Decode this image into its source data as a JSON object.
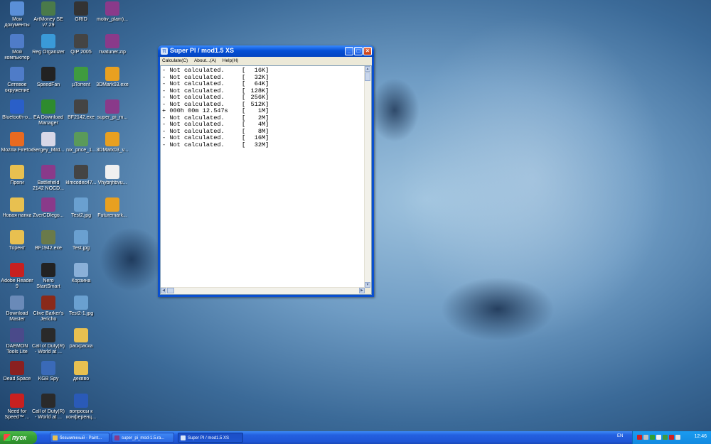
{
  "desktop": {
    "icons": [
      {
        "label": "Мои документы",
        "icon": "folder-docs-icon",
        "color": "#5a8fd8"
      },
      {
        "label": "ArtMoney SE v7.29",
        "icon": "artmoney-icon",
        "color": "#4a7a4a"
      },
      {
        "label": "GRID",
        "icon": "grid-game-icon",
        "color": "#333333"
      },
      {
        "label": "motiv_plam)...",
        "icon": "winrar-icon",
        "color": "#8a3a8a"
      },
      {
        "label": "Мой компьютер",
        "icon": "computer-icon",
        "color": "#4f7cc8"
      },
      {
        "label": "Reg Organizer",
        "icon": "reg-organizer-icon",
        "color": "#3a9ad8"
      },
      {
        "label": "QIP 2005",
        "icon": "qip-icon",
        "color": "#444444"
      },
      {
        "label": "rivatuner.zip",
        "icon": "winrar-icon",
        "color": "#8a3a8a"
      },
      {
        "label": "Сетевое окружение",
        "icon": "network-icon",
        "color": "#4f7cc8"
      },
      {
        "label": "SpeedFan",
        "icon": "speedfan-icon",
        "color": "#222222"
      },
      {
        "label": "µTorrent",
        "icon": "utorrent-icon",
        "color": "#3f9b3f"
      },
      {
        "label": "3DMark03.exe",
        "icon": "futuremark-icon",
        "color": "#e8a020"
      },
      {
        "label": "Bluetooth-о...",
        "icon": "bluetooth-icon",
        "color": "#2a5fc8"
      },
      {
        "label": "EA Download Manager",
        "icon": "ea-icon",
        "color": "#2e8b2e"
      },
      {
        "label": "BF2142.exe",
        "icon": "bf2142-icon",
        "color": "#444444"
      },
      {
        "label": "super_pi_m...",
        "icon": "winrar-icon",
        "color": "#8a3a8a"
      },
      {
        "label": "Mozilla Firefox",
        "icon": "firefox-icon",
        "color": "#e86a20"
      },
      {
        "label": "Sergey_Mild...",
        "icon": "document-icon",
        "color": "#d8d8e8"
      },
      {
        "label": "nix_price_1...",
        "icon": "spreadsheet-icon",
        "color": "#5a9a5a"
      },
      {
        "label": "3DMark03_v...",
        "icon": "futuremark-icon",
        "color": "#e8a020"
      },
      {
        "label": "Проги",
        "icon": "folder-icon",
        "color": "#e8c050"
      },
      {
        "label": "Battlefield 2142 NOCD...",
        "icon": "winrar-icon",
        "color": "#8a3a8a"
      },
      {
        "label": "klmcodec47...",
        "icon": "codec-icon",
        "color": "#444444"
      },
      {
        "label": "Vhybrjhbvu...",
        "icon": "text-file-icon",
        "color": "#f0f0f0"
      },
      {
        "label": "Новая папка",
        "icon": "folder-icon",
        "color": "#e8c050"
      },
      {
        "label": "ZverCDlego...",
        "icon": "winrar-icon",
        "color": "#8a3a8a"
      },
      {
        "label": "Test2.jpg",
        "icon": "image-icon",
        "color": "#6aa0d0"
      },
      {
        "label": "Futuremark...",
        "icon": "futuremark-icon",
        "color": "#e8a020"
      },
      {
        "label": "Торент",
        "icon": "folder-icon",
        "color": "#e8c050"
      },
      {
        "label": "BF1942.exe",
        "icon": "bf1942-icon",
        "color": "#6a7a4a"
      },
      {
        "label": "Test.jpg",
        "icon": "image-icon",
        "color": "#6aa0d0"
      },
      {
        "label": "Adobe Reader 9",
        "icon": "adobe-reader-icon",
        "color": "#c82020"
      },
      {
        "label": "Nero StartSmart",
        "icon": "nero-icon",
        "color": "#222222"
      },
      {
        "label": "Корзина",
        "icon": "recycle-bin-icon",
        "color": "#8ab0d8"
      },
      {
        "label": "Download Master",
        "icon": "download-master-icon",
        "color": "#6a8ab8"
      },
      {
        "label": "Clive Barker's Jericho",
        "icon": "jericho-icon",
        "color": "#8a2a1a"
      },
      {
        "label": "Test2-1.jpg",
        "icon": "image-icon",
        "color": "#6aa0d0"
      },
      {
        "label": "DAEMON Tools Lite",
        "icon": "daemon-tools-icon",
        "color": "#4a4a8a"
      },
      {
        "label": "Call of Duty(R) - World at ...",
        "icon": "cod-icon",
        "color": "#2a2a2a"
      },
      {
        "label": "раскраска",
        "icon": "folder-icon",
        "color": "#e8c050"
      },
      {
        "label": "Dead Space",
        "icon": "dead-space-icon",
        "color": "#8a2020"
      },
      {
        "label": "KGB Spy",
        "icon": "kgb-spy-icon",
        "color": "#3a6ab8"
      },
      {
        "label": "деквво",
        "icon": "folder-icon",
        "color": "#e8c050"
      },
      {
        "label": "Need for Speed™ ...",
        "icon": "nfs-icon",
        "color": "#c82020"
      },
      {
        "label": "Call of Duty(R) - World at ...",
        "icon": "cod-icon",
        "color": "#2a2a2a"
      },
      {
        "label": "вопросы к конференц...",
        "icon": "word-doc-icon",
        "color": "#2a5ab8"
      }
    ]
  },
  "window": {
    "title": "Super PI / mod1.5 XS",
    "menu": [
      "Calculate(C)",
      "About...(A)",
      "Help(H)"
    ],
    "results": [
      {
        "status": "- Not calculated.",
        "size": "16K"
      },
      {
        "status": "- Not calculated.",
        "size": "32K"
      },
      {
        "status": "- Not calculated.",
        "size": "64K"
      },
      {
        "status": "- Not calculated.",
        "size": "128K"
      },
      {
        "status": "- Not calculated.",
        "size": "256K"
      },
      {
        "status": "- Not calculated.",
        "size": "512K"
      },
      {
        "status": "+ 000h 00m 12.547s",
        "size": "1M"
      },
      {
        "status": "- Not calculated.",
        "size": "2M"
      },
      {
        "status": "- Not calculated.",
        "size": "4M"
      },
      {
        "status": "- Not calculated.",
        "size": "8M"
      },
      {
        "status": "- Not calculated.",
        "size": "16M"
      },
      {
        "status": "- Not calculated.",
        "size": "32M"
      }
    ],
    "min_glyph": "_",
    "max_glyph": "□",
    "close_glyph": "×"
  },
  "taskbar": {
    "start_label": "пуск",
    "tasks": [
      {
        "label": "безымянный - Paint...",
        "icon_color": "#e8c050",
        "active": false
      },
      {
        "label": "super_pi_mod-1.5.ra...",
        "icon_color": "#8a3a8a",
        "active": false
      },
      {
        "label": "Super PI / mod1.5 XS",
        "icon_color": "#d8e6f8",
        "active": true
      }
    ],
    "language": "EN",
    "clock": "12:46",
    "tray_icons": [
      {
        "icon": "ati-icon",
        "color": "#d02020"
      },
      {
        "icon": "network-tray-icon",
        "color": "#c0c0c0"
      },
      {
        "icon": "shield-tray-icon",
        "color": "#30a030"
      },
      {
        "icon": "qip-tray-icon",
        "color": "#f0f0f0"
      },
      {
        "icon": "utorrent-tray-icon",
        "color": "#3f9b3f"
      },
      {
        "icon": "en-tray-icon",
        "color": "#d02020"
      },
      {
        "icon": "speaker-icon",
        "color": "#e0e0e0"
      }
    ]
  }
}
